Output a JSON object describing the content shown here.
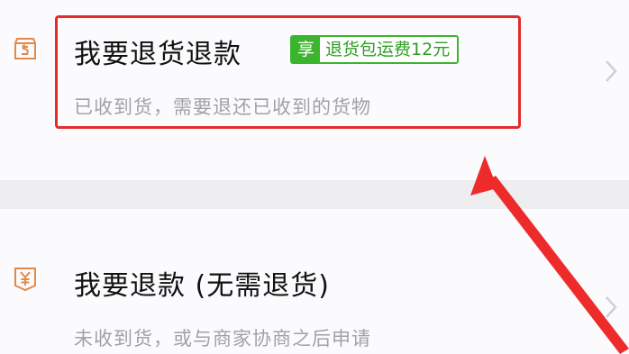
{
  "options": [
    {
      "title": "我要退货退款",
      "subtitle": "已收到货，需要退还已收到的货物",
      "icon": "return-box-icon",
      "promo": {
        "tag": "享",
        "text": "退货包运费12元"
      }
    },
    {
      "title": "我要退款 (无需退货)",
      "subtitle": "未收到货，或与商家协商之后申请",
      "icon": "yen-refund-icon"
    }
  ],
  "colors": {
    "icon_orange": "#e28a4a",
    "highlight_red": "#e62b2b",
    "promo_green": "#3bb52d",
    "arrow_red": "#ee2b2b"
  }
}
